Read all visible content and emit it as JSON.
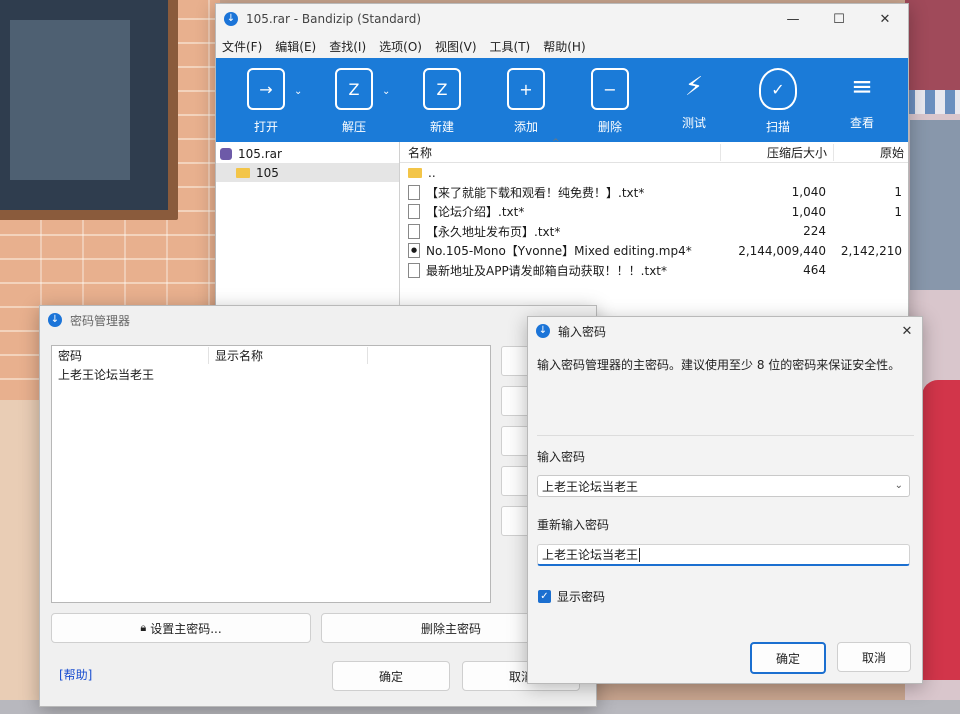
{
  "bandizip": {
    "title": "105.rar - Bandizip (Standard)",
    "controls": {
      "minimize": "—",
      "maximize": "☐",
      "close": "✕"
    },
    "menu": [
      "文件(F)",
      "编辑(E)",
      "查找(I)",
      "选项(O)",
      "视图(V)",
      "工具(T)",
      "帮助(H)"
    ],
    "toolbar": [
      {
        "label": "打开",
        "icon": "open-icon",
        "glyph": "→",
        "dropdown": true
      },
      {
        "label": "解压",
        "icon": "extract-icon",
        "glyph": "Z",
        "dropdown": true
      },
      {
        "label": "新建",
        "icon": "new-archive-icon",
        "glyph": "Z",
        "dropdown": false
      },
      {
        "label": "添加",
        "icon": "add-icon",
        "glyph": "+",
        "dropdown": false
      },
      {
        "label": "删除",
        "icon": "delete-icon",
        "glyph": "−",
        "dropdown": false
      },
      {
        "label": "测试",
        "icon": "test-icon",
        "glyph": "⚡",
        "dropdown": false
      },
      {
        "label": "扫描",
        "icon": "scan-icon",
        "glyph": "✓",
        "dropdown": false
      },
      {
        "label": "查看",
        "icon": "view-icon",
        "glyph": "≡",
        "dropdown": false
      }
    ],
    "tree": {
      "root": "105.rar",
      "child": "105"
    },
    "columns": {
      "name": "名称",
      "packed": "压缩后大小",
      "original": "原始"
    },
    "files": [
      {
        "name": "..",
        "packed": "",
        "original": "",
        "type": "folder"
      },
      {
        "name": "【来了就能下载和观看！纯免费！】.txt*",
        "packed": "1,040",
        "original": "1",
        "type": "doc"
      },
      {
        "name": "【论坛介绍】.txt*",
        "packed": "1,040",
        "original": "1",
        "type": "doc"
      },
      {
        "name": "【永久地址发布页】.txt*",
        "packed": "224",
        "original": "",
        "type": "doc"
      },
      {
        "name": "No.105-Mono【Yvonne】Mixed editing.mp4*",
        "packed": "2,144,009,440",
        "original": "2,142,210",
        "type": "mp4"
      },
      {
        "name": "最新地址及APP请发邮箱自动获取！！！.txt*",
        "packed": "464",
        "original": "",
        "type": "doc"
      }
    ]
  },
  "pwmgr": {
    "title": "密码管理器",
    "columns": {
      "password": "密码",
      "display_name": "显示名称"
    },
    "rows": [
      {
        "password": "上老王论坛当老王",
        "display_name": ""
      }
    ],
    "set_master": "设置主密码...",
    "delete_master": "删除主密码",
    "help": "[帮助]",
    "ok": "确定",
    "cancel": "取消"
  },
  "enterpw": {
    "title": "输入密码",
    "description": "输入密码管理器的主密码。建议使用至少 8 位的密码来保证安全性。",
    "field1_label": "输入密码",
    "field1_value": "上老王论坛当老王",
    "field2_label": "重新输入密码",
    "field2_value": "上老王论坛当老王",
    "show_password": "显示密码",
    "show_password_checked": true,
    "ok": "确定",
    "cancel": "取消",
    "close": "✕"
  },
  "colors": {
    "accent": "#1b7bd8",
    "focus": "#1b6fd0",
    "help_link": "#1b4fd0"
  }
}
